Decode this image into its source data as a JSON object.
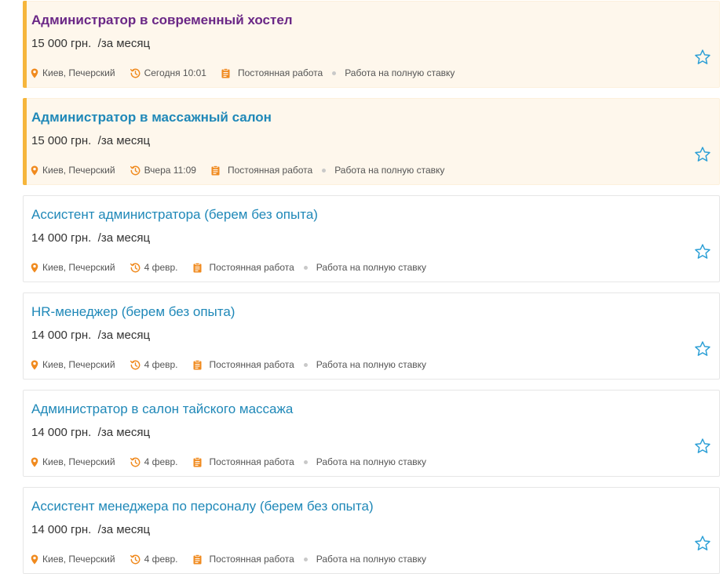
{
  "colors": {
    "title_visited": "#6a2786",
    "title_link": "#1f88b8",
    "accent": "#f08a1e",
    "star": "#2b9fd6",
    "highlight_bg": "#fef7ec",
    "highlight_bar": "#f6b63c"
  },
  "icons": {
    "location": "map-pin-icon",
    "time": "history-clock-icon",
    "type": "clipboard-icon",
    "favorite": "star-outline-icon"
  },
  "jobs": [
    {
      "title": "Администратор в современный хостел",
      "salary": "15 000 грн.",
      "period": "/за месяц",
      "location": "Киев, Печерский",
      "date": "Сегодня 10:01",
      "type": "Постоянная работа",
      "schedule": "Работа на полную ставку",
      "highlighted": true,
      "visited": true
    },
    {
      "title": "Администратор в массажный салон",
      "salary": "15 000 грн.",
      "period": "/за месяц",
      "location": "Киев, Печерский",
      "date": "Вчера 11:09",
      "type": "Постоянная работа",
      "schedule": "Работа на полную ставку",
      "highlighted": true,
      "visited": false
    },
    {
      "title": "Ассистент администратора (берем без опыта)",
      "salary": "14 000 грн.",
      "period": "/за месяц",
      "location": "Киев, Печерский",
      "date": "4 февр.",
      "type": "Постоянная работа",
      "schedule": "Работа на полную ставку",
      "highlighted": false,
      "visited": false
    },
    {
      "title": "HR-менеджер (берем без опыта)",
      "salary": "14 000 грн.",
      "period": "/за месяц",
      "location": "Киев, Печерский",
      "date": "4 февр.",
      "type": "Постоянная работа",
      "schedule": "Работа на полную ставку",
      "highlighted": false,
      "visited": false
    },
    {
      "title": "Администратор в салон тайского массажа",
      "salary": "14 000 грн.",
      "period": "/за месяц",
      "location": "Киев, Печерский",
      "date": "4 февр.",
      "type": "Постоянная работа",
      "schedule": "Работа на полную ставку",
      "highlighted": false,
      "visited": false
    },
    {
      "title": "Ассистент менеджера по персоналу (берем без опыта)",
      "salary": "14 000 грн.",
      "period": "/за месяц",
      "location": "Киев, Печерский",
      "date": "4 февр.",
      "type": "Постоянная работа",
      "schedule": "Работа на полную ставку",
      "highlighted": false,
      "visited": false
    }
  ]
}
